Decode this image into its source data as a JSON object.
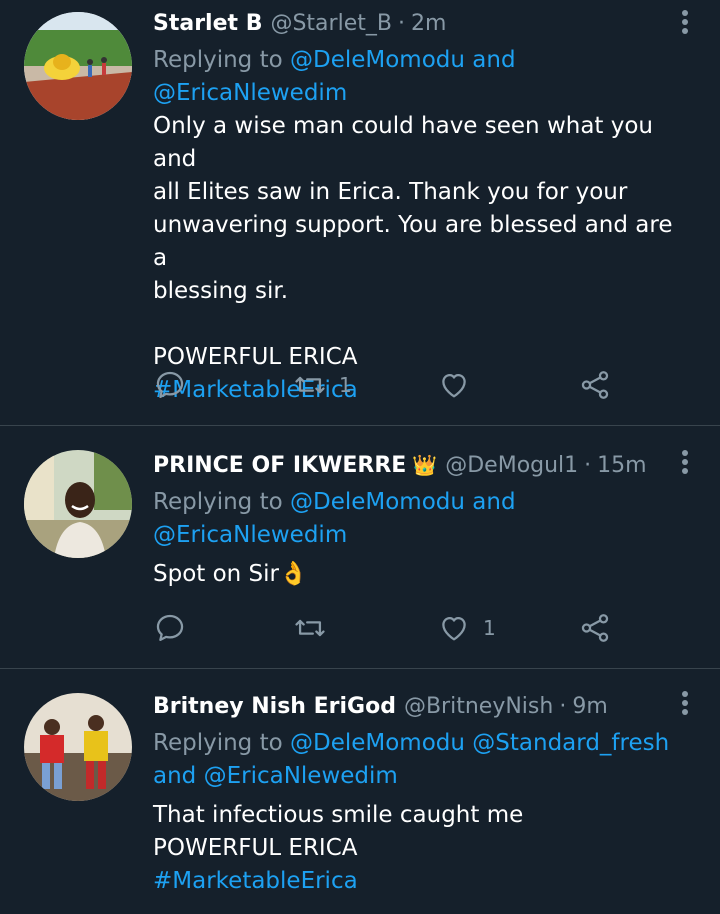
{
  "tweets": [
    {
      "name": "Starlet B",
      "handle": "@Starlet_B",
      "sep": "·",
      "time": "2m",
      "replying_prefix": "Replying to",
      "mention1": "@DeleMomodu",
      "and": "and",
      "mention2": "@EricaNlewedim",
      "text_lines": [
        "Only a wise man could have seen what you and",
        "all Elites saw in Erica. Thank you for your",
        "unwavering support. You are blessed and are a",
        "blessing sir."
      ],
      "extra_line": "POWERFUL ERICA",
      "hashtag": "#MarketableErica",
      "retweets": "1",
      "likes": ""
    },
    {
      "name": "PRINCE OF IKWERRE",
      "crown": "👑",
      "handle": "@DeMogul1",
      "sep": "·",
      "time": "15m",
      "replying_prefix": "Replying to",
      "mention1": "@DeleMomodu",
      "and": "and",
      "mention2": "@EricaNlewedim",
      "text": "Spot on Sir",
      "emoji": "👌",
      "retweets": "",
      "likes": "1"
    },
    {
      "name": "Britney Nish EriGod",
      "handle": "@BritneyNish",
      "sep": "·",
      "time": "9m",
      "replying_prefix": "Replying to",
      "mention1": "@DeleMomodu",
      "mention2": "@Standard_fresh",
      "and": "and",
      "mention3": "@EricaNlewedim",
      "text_lines": [
        "That infectious smile caught me",
        "POWERFUL ERICA"
      ],
      "hashtag": "#MarketableErica"
    }
  ],
  "colors": {
    "background": "#15202b",
    "link": "#1da1f2",
    "muted": "#8899a6",
    "divider": "#38444d"
  },
  "icons": [
    "reply-icon",
    "retweet-icon",
    "like-icon",
    "share-icon",
    "more-options-icon",
    "crown-emoji",
    "ok-hand-emoji"
  ]
}
